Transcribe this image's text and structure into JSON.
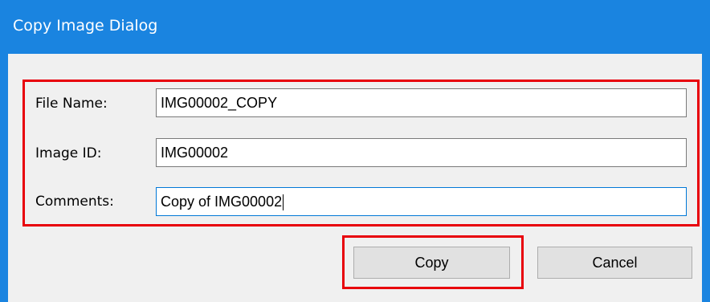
{
  "window": {
    "title": "Copy Image Dialog"
  },
  "form": {
    "file_name": {
      "label": "File Name:",
      "value": "IMG00002_COPY"
    },
    "image_id": {
      "label": "Image ID:",
      "value": "IMG00002"
    },
    "comments": {
      "label": "Comments:",
      "value": "Copy of IMG00002"
    }
  },
  "buttons": {
    "copy_label": "Copy",
    "cancel_label": "Cancel"
  },
  "colors": {
    "titlebar": "#1a84e0",
    "highlight": "#e8000b",
    "dialog_background": "#f0f0f0",
    "active_field_border": "#0078d7"
  },
  "icons": {
    "text_caret": "text-caret-icon"
  }
}
